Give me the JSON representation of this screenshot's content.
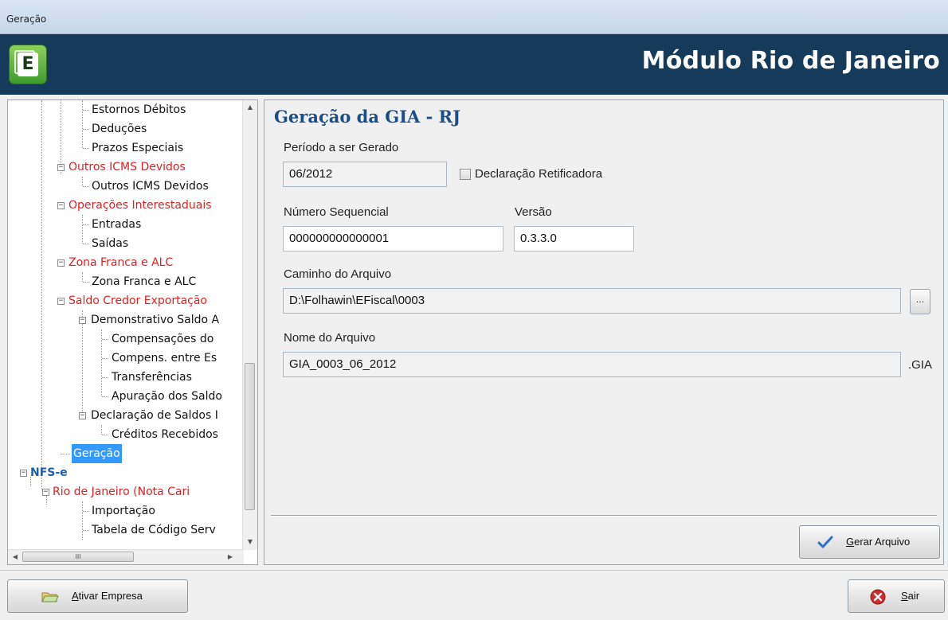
{
  "window": {
    "title": "Geração"
  },
  "header": {
    "title": "Módulo Rio de Janeiro",
    "logo_letter": "E"
  },
  "tree": {
    "items": [
      {
        "label": "Estornos Débitos",
        "color": "black"
      },
      {
        "label": "Deduções",
        "color": "black"
      },
      {
        "label": "Prazos Especiais",
        "color": "black"
      },
      {
        "label": "Outros ICMS Devidos",
        "color": "red"
      },
      {
        "label": "Outros ICMS Devidos",
        "color": "black"
      },
      {
        "label": "Operações Interestaduais",
        "color": "red"
      },
      {
        "label": "Entradas",
        "color": "black"
      },
      {
        "label": "Saídas",
        "color": "black"
      },
      {
        "label": "Zona Franca e ALC",
        "color": "red"
      },
      {
        "label": "Zona Franca e ALC",
        "color": "black"
      },
      {
        "label": "Saldo Credor Exportação",
        "color": "red"
      },
      {
        "label": "Demonstrativo Saldo A",
        "color": "black"
      },
      {
        "label": "Compensações do",
        "color": "black"
      },
      {
        "label": "Compens. entre Es",
        "color": "black"
      },
      {
        "label": "Transferências",
        "color": "black"
      },
      {
        "label": "Apuração dos Saldo",
        "color": "black"
      },
      {
        "label": "Declaração de Saldos I",
        "color": "black"
      },
      {
        "label": "Créditos Recebidos",
        "color": "black"
      },
      {
        "label": "Geração",
        "color": "selected"
      },
      {
        "label": "NFS-e",
        "color": "blue"
      },
      {
        "label": "Rio de Janeiro (Nota Cari",
        "color": "red"
      },
      {
        "label": "Importação",
        "color": "black"
      },
      {
        "label": "Tabela de Código Serv",
        "color": "black"
      }
    ]
  },
  "form": {
    "heading": "Geração da GIA - RJ",
    "periodo_label": "Período a ser Gerado",
    "periodo_value": "06/2012",
    "retificadora_label": "Declaração Retificadora",
    "retificadora_checked": false,
    "numero_label": "Número Sequencial",
    "numero_value": "000000000000001",
    "versao_label": "Versão",
    "versao_value": "0.3.3.0",
    "caminho_label": "Caminho do Arquivo",
    "caminho_value": "D:\\Folhawin\\EFiscal\\0003",
    "browse_label": "...",
    "nome_label": "Nome do Arquivo",
    "nome_value": "GIA_0003_06_2012",
    "extensao": ".GIA",
    "gerar_label_first": "G",
    "gerar_label_rest": "erar Arquivo"
  },
  "footer": {
    "ativar_label_first": "A",
    "ativar_label_rest": "tivar Empresa",
    "sair_label_first": "S",
    "sair_label_rest": "air"
  },
  "colors": {
    "header_bg": "#163a59",
    "heading": "#1b4e86",
    "tree_red": "#e02020",
    "tree_blue": "#1a5fb4",
    "selection": "#3399ff"
  }
}
